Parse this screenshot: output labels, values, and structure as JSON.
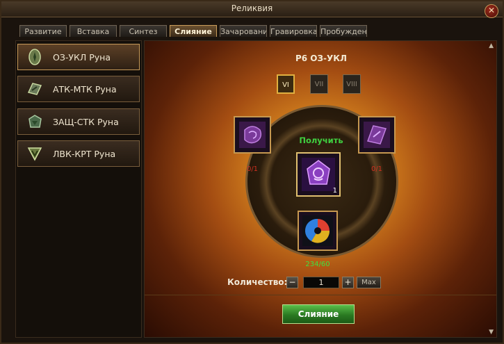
{
  "window": {
    "title": "Реликвия"
  },
  "tabs": [
    "Развитие",
    "Вставка",
    "Синтез",
    "Слияние",
    "Зачарование",
    "Гравировка",
    "Пробуждение"
  ],
  "active_tab": "Слияние",
  "runes": [
    {
      "label": "ОЗ-УКЛ Руна",
      "selected": true
    },
    {
      "label": "АТК-МТК Руна",
      "selected": false
    },
    {
      "label": "ЗАЩ-СТК Руна",
      "selected": false
    },
    {
      "label": "ЛВК-КРТ Руна",
      "selected": false
    }
  ],
  "fusion": {
    "title": "Р6 ОЗ-УКЛ",
    "tiers": [
      "VI",
      "VII",
      "VIII"
    ],
    "active_tier": "VI",
    "get_label": "Получить",
    "left_material_count": "0/1",
    "right_material_count": "0/1",
    "result_count": "1",
    "catalyst_count": "234/60",
    "quantity_label": "Количество:",
    "quantity_value": "1",
    "minus_label": "−",
    "plus_label": "+",
    "max_label": "Max",
    "merge_label": "Слияние"
  },
  "colors": {
    "accent": "#c89a58",
    "green": "#40e040",
    "red": "#d03020"
  }
}
